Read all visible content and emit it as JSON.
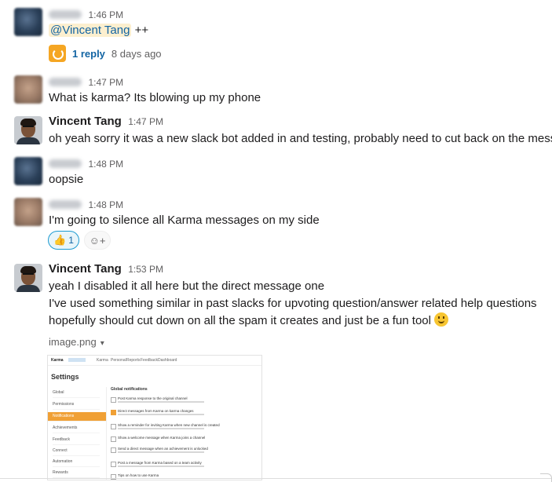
{
  "messages": [
    {
      "author": "",
      "time": "1:46 PM",
      "mention": "@Vincent Tang",
      "text_after_mention": " ++",
      "thread": {
        "replies": "1 reply",
        "when": "8 days ago"
      }
    },
    {
      "author": "",
      "time": "1:47 PM",
      "text": "What is karma? Its blowing up my phone"
    },
    {
      "author": "Vincent Tang",
      "time": "1:47 PM",
      "text": "oh yeah sorry it was a new slack bot added in and testing, probably need to cut back on the messa"
    },
    {
      "author": "",
      "time": "1:48 PM",
      "text": "oopsie"
    },
    {
      "author": "",
      "time": "1:48 PM",
      "text": "I'm going to silence all Karma messages on my side",
      "reaction": {
        "emoji": "👍",
        "count": "1"
      },
      "add_reaction_icon": "add-emoji-icon"
    },
    {
      "author": "Vincent Tang",
      "time": "1:53 PM",
      "lines": [
        "yeah I disabled it all here but the direct message one",
        "I've used something similar in past slacks for upvoting question/answer related help questions",
        "hopefully should cut down on all the spam it creates and just be a fun tool"
      ],
      "attachment": {
        "filename": "image.png",
        "chevron": "▾"
      }
    }
  ],
  "preview": {
    "top_links": [
      "Karma",
      "Personal",
      "Reports",
      "Feedback",
      "Dashboard"
    ],
    "title": "Settings",
    "sidebar": [
      "Global",
      "Permissions",
      "Notifications",
      "Achievements",
      "Feedback",
      "Connect",
      "Automation",
      "Rewards"
    ],
    "selected_index": 2,
    "section": "Global notifications",
    "options": [
      {
        "label": "Post Karma response to the original channel",
        "checked": false
      },
      {
        "label": "Direct messages from Karma on karma changes",
        "checked": true
      },
      {
        "label": "Show a reminder for inviting Karma when new channel is created",
        "checked": false
      },
      {
        "label": "Show a welcome message when Karma joins a channel",
        "checked": false
      },
      {
        "label": "Send a direct message when an achievement is unlocked",
        "checked": false
      },
      {
        "label": "Post a message from Karma based on a team activity",
        "checked": false
      },
      {
        "label": "Tips on how to use Karma",
        "checked": false
      }
    ]
  },
  "colors": {
    "link": "#1264a3",
    "mention_bg": "#fcefcf",
    "accent": "#f0a035"
  }
}
